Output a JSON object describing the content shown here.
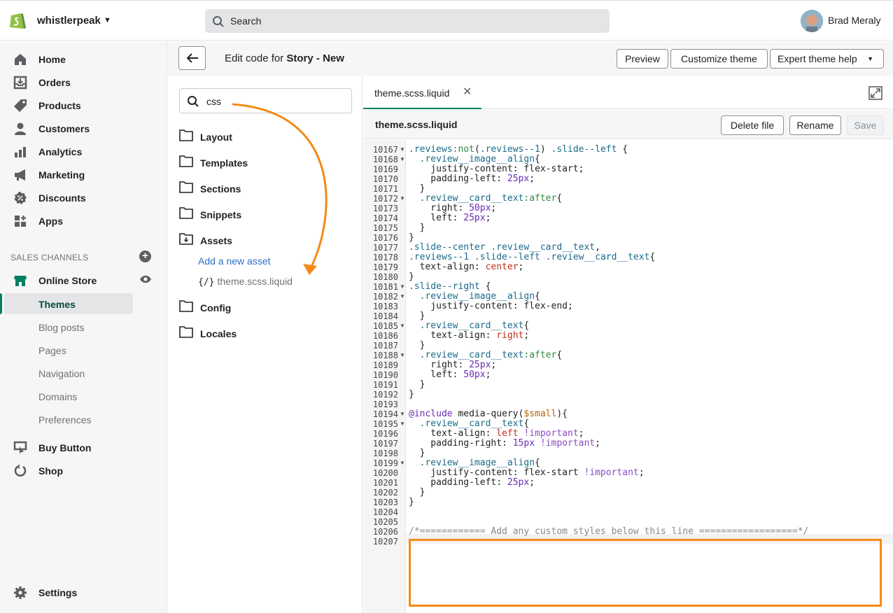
{
  "topbar": {
    "store_name": "whistlerpeak",
    "search_placeholder": "Search",
    "user_name": "Brad Meraly"
  },
  "sidebar": {
    "items": [
      {
        "label": "Home",
        "icon": "home-icon"
      },
      {
        "label": "Orders",
        "icon": "orders-icon"
      },
      {
        "label": "Products",
        "icon": "tag-icon"
      },
      {
        "label": "Customers",
        "icon": "person-icon"
      },
      {
        "label": "Analytics",
        "icon": "bar-chart-icon"
      },
      {
        "label": "Marketing",
        "icon": "megaphone-icon"
      },
      {
        "label": "Discounts",
        "icon": "discount-icon"
      },
      {
        "label": "Apps",
        "icon": "apps-icon"
      }
    ],
    "sales_channels_heading": "SALES CHANNELS",
    "online_store": "Online Store",
    "online_store_sub": [
      "Themes",
      "Blog posts",
      "Pages",
      "Navigation",
      "Domains",
      "Preferences"
    ],
    "other_channels": [
      "Buy Button",
      "Shop"
    ],
    "settings": "Settings"
  },
  "header": {
    "title_prefix": "Edit code for ",
    "theme_name": "Story - New",
    "preview": "Preview",
    "customize": "Customize theme",
    "expert_help": "Expert theme help"
  },
  "files": {
    "search_value": "css",
    "folders": [
      "Layout",
      "Templates",
      "Sections",
      "Snippets",
      "Assets",
      "Config",
      "Locales"
    ],
    "add_asset": "Add a new asset",
    "asset_file": "theme.scss.liquid",
    "asset_prefix": "{/}"
  },
  "editor": {
    "tab_label": "theme.scss.liquid",
    "file_name": "theme.scss.liquid",
    "delete": "Delete file",
    "rename": "Rename",
    "save": "Save",
    "line_numbers": [
      "10167",
      "10168",
      "10169",
      "10170",
      "10171",
      "10172",
      "10173",
      "10174",
      "10175",
      "10176",
      "10177",
      "10178",
      "10179",
      "10180",
      "10181",
      "10182",
      "10183",
      "10184",
      "10185",
      "10186",
      "10187",
      "10188",
      "10189",
      "10190",
      "10191",
      "10192",
      "10193",
      "10194",
      "10195",
      "10196",
      "10197",
      "10198",
      "10199",
      "10200",
      "10201",
      "10202",
      "10203",
      "10204",
      "10205",
      "10206",
      "10207"
    ],
    "lines": [
      ".reviews:not(.reviews--1) .slide--left {",
      "  .review__image__align{",
      "    justify-content: flex-start;",
      "    padding-left: 25px;",
      "  }",
      "  .review__card__text:after{",
      "    right: 50px;",
      "    left: 25px;",
      "  }",
      "}",
      ".slide--center .review__card__text,",
      ".reviews--1 .slide--left .review__card__text{",
      "  text-align: center;",
      "}",
      ".slide--right {",
      "  .review__image__align{",
      "    justify-content: flex-end;",
      "  }",
      "  .review__card__text{",
      "    text-align: right;",
      "  }",
      "  .review__card__text:after{",
      "    right: 25px;",
      "    left: 50px;",
      "  }",
      "}",
      "",
      "@include media-query($small){",
      "  .review__card__text{",
      "    text-align: left !important;",
      "    padding-right: 15px !important;",
      "  }",
      "  .review__image__align{",
      "    justify-content: flex-start !important;",
      "    padding-left: 25px;",
      "  }",
      "}",
      "",
      "",
      "/*============ Add any custom styles below this line ==================*/",
      ""
    ]
  },
  "colors": {
    "accent": "#008060",
    "annotation": "#f48b16",
    "link": "#2c6ecb"
  }
}
